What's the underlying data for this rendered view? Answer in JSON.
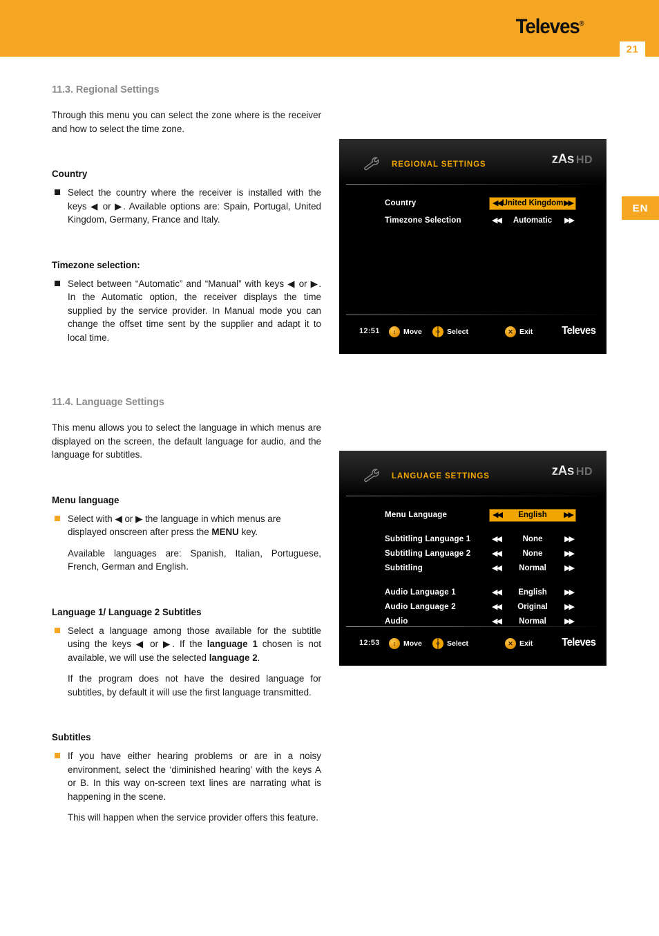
{
  "header": {
    "brand": "Televes",
    "brand_reg": "®",
    "page_number": "21",
    "accent_color": "#f5a623"
  },
  "language_tab": {
    "label": "EN"
  },
  "sections": [
    {
      "id": "regional",
      "heading": "11.3. Regional Settings",
      "intro": "Through this menu you can select the zone where is the receiver and how to select the time zone.",
      "blocks": [
        {
          "sub_heading": "Country",
          "bullet_color": "black",
          "bullet_html": "Select the country where the receiver is installed with the keys ◀ or ▶. Available options are: Spain, Portugal, United Kingdom, Germany, France and Italy."
        },
        {
          "sub_heading": "Timezone selection:",
          "bullet_color": "black",
          "bullet_html": "Select between “Automatic” and “Manual” with keys ◀ or ▶. In the Automatic option, the receiver displays the time supplied by the service provider. In Manual mode you can change the offset time sent by the supplier and adapt it to local time."
        }
      ]
    },
    {
      "id": "language",
      "heading": "11.4. Language Settings",
      "intro": "This menu allows you to select the language in which menus are displayed on the screen, the default language for audio, and the language for subtitles.",
      "blocks": [
        {
          "sub_heading": "Menu language",
          "bullet_color": "orange",
          "bullet_html": "Select with ◀ or ▶ the language in which menus are displayed onscreen after press the <b>MENU</b> key.",
          "follow_up": "Available languages are: Spanish, Italian, Portuguese, French, German and English."
        },
        {
          "sub_heading": "Language 1/ Language 2 Subtitles",
          "bullet_color": "orange",
          "bullet_html": "Select a language among those available for the subtitle using the keys ◀ or ▶. If the <b>language 1</b> chosen is not available, we will use the selected <b>language 2</b>.",
          "follow_up": "If the program does not have the desired language for subtitles, by default it will use the first language transmitted."
        },
        {
          "sub_heading": "Subtitles",
          "bullet_color": "orange",
          "bullet_html": "If you have either hearing problems or are in a noisy environment, select the ‘diminished hearing’ with the keys A or B. In this way on-screen text lines are narrating what is happening in the scene.",
          "follow_up": "This will happen when the service provider offers this feature."
        }
      ]
    }
  ],
  "screenshots": [
    {
      "id": "regional",
      "title": "REGIONAL SETTINGS",
      "logo_main": "zAs",
      "logo_sub": "HD",
      "rows": [
        {
          "label": "Country",
          "value": "United Kingdom",
          "selected": true
        },
        {
          "label": "Timezone Selection",
          "value": "Automatic",
          "selected": false
        }
      ],
      "footer": {
        "time": "12:51",
        "move": "Move",
        "select": "Select",
        "exit": "Exit",
        "brand": "Televes"
      },
      "highlight_color": "#f0a500",
      "title_color": "#f0a500"
    },
    {
      "id": "language",
      "title": "LANGUAGE SETTINGS",
      "logo_main": "zAs",
      "logo_sub": "HD",
      "rows": [
        {
          "label": "Menu Language",
          "value": "English",
          "selected": true
        },
        {
          "label": "Subtitling Language 1",
          "value": "None",
          "selected": false
        },
        {
          "label": "Subtitling Language 2",
          "value": "None",
          "selected": false
        },
        {
          "label": "Subtitling",
          "value": "Normal",
          "selected": false
        },
        {
          "label": "Audio Language 1",
          "value": "English",
          "selected": false
        },
        {
          "label": "Audio Language 2",
          "value": "Original",
          "selected": false
        },
        {
          "label": "Audio",
          "value": "Normal",
          "selected": false
        }
      ],
      "footer": {
        "time": "12:53",
        "move": "Move",
        "select": "Select",
        "exit": "Exit",
        "brand": "Televes"
      },
      "highlight_color": "#f0a500",
      "title_color": "#f0a500"
    }
  ],
  "glyphs": {
    "arrow_left_double": "◀◀",
    "arrow_right_double": "▶▶",
    "move_icon": "↕",
    "select_icon": "‹›",
    "exit_icon": "✕"
  }
}
